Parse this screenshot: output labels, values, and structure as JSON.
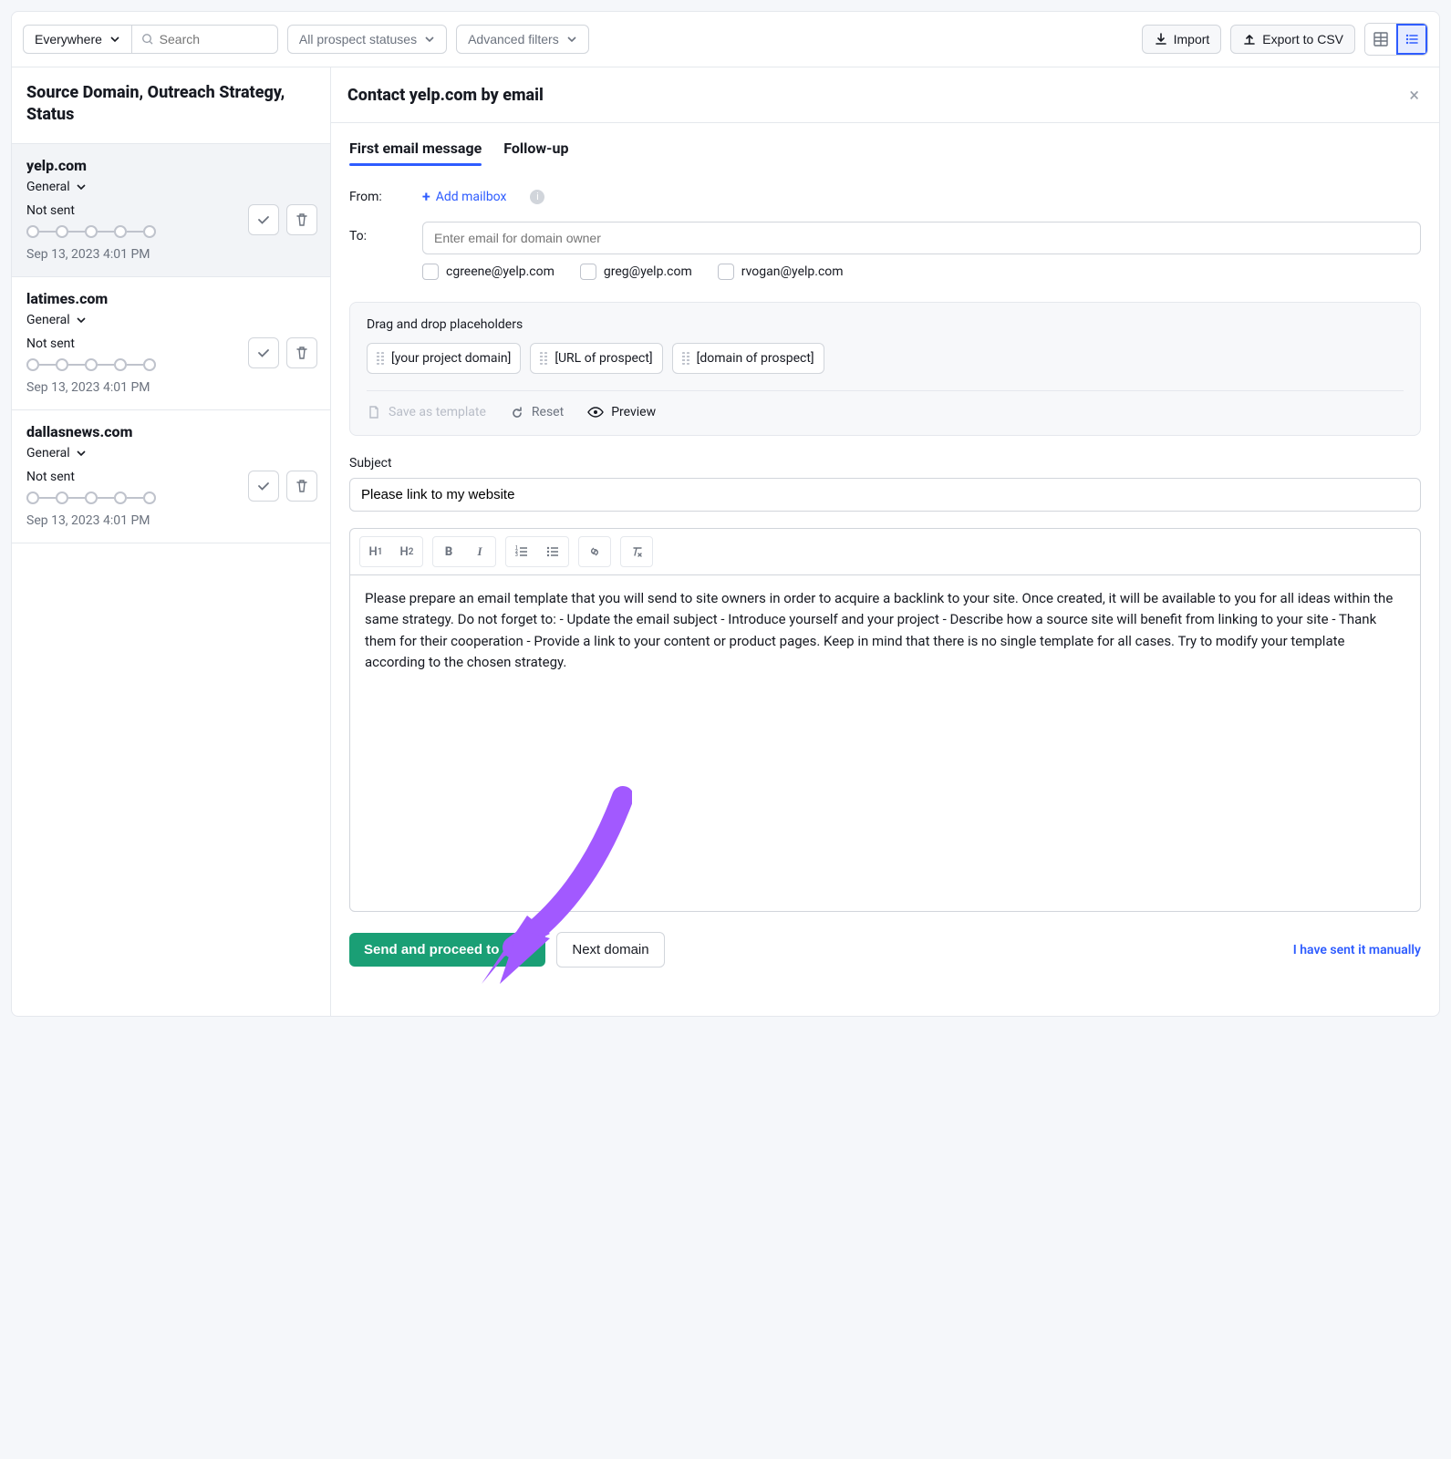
{
  "toolbar": {
    "scope": "Everywhere",
    "search_placeholder": "Search",
    "status_filter": "All prospect statuses",
    "advanced_filters": "Advanced filters",
    "import": "Import",
    "export": "Export to CSV"
  },
  "sidebar": {
    "header": "Source Domain, Outreach Strategy, Status",
    "items": [
      {
        "domain": "yelp.com",
        "strategy": "General",
        "status": "Not sent",
        "date": "Sep 13, 2023 4:01 PM",
        "active": true
      },
      {
        "domain": "latimes.com",
        "strategy": "General",
        "status": "Not sent",
        "date": "Sep 13, 2023 4:01 PM",
        "active": false
      },
      {
        "domain": "dallasnews.com",
        "strategy": "General",
        "status": "Not sent",
        "date": "Sep 13, 2023 4:01 PM",
        "active": false
      }
    ]
  },
  "content": {
    "title": "Contact yelp.com by email",
    "tabs": {
      "first": "First email message",
      "follow": "Follow-up"
    },
    "from_label": "From:",
    "add_mailbox": "Add mailbox",
    "to_label": "To:",
    "to_placeholder": "Enter email for domain owner",
    "emails": [
      "cgreene@yelp.com",
      "greg@yelp.com",
      "rvogan@yelp.com"
    ],
    "placeholders_title": "Drag and drop placeholders",
    "placeholders": [
      "[your project domain]",
      "[URL of prospect]",
      "[domain of prospect]"
    ],
    "save_template": "Save as template",
    "reset": "Reset",
    "preview": "Preview",
    "subject_label": "Subject",
    "subject_value": "Please link to my website",
    "body": "Please prepare an email template that you will send to site owners in order to acquire a backlink to your site. Once created, it will be available to you for all ideas within the same strategy. Do not forget to: - Update the email subject - Introduce yourself and your project - Describe how a source site will benefit from linking to your site - Thank them for their cooperation - Provide a link to your content or product pages. Keep in mind that there is no single template for all cases. Try to modify your template according to the chosen strategy.",
    "footer": {
      "send": "Send and proceed to next",
      "next": "Next domain",
      "manual": "I have sent it manually"
    }
  }
}
